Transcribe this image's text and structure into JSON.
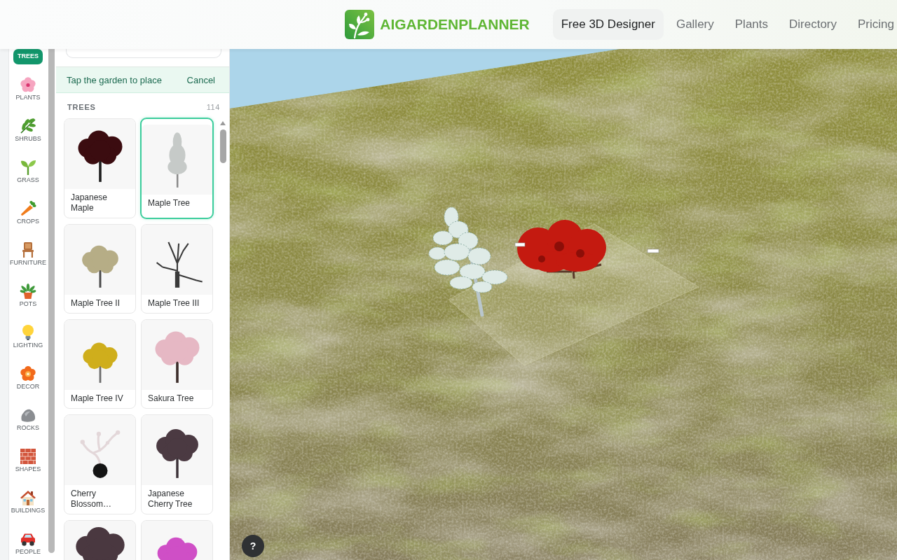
{
  "header": {
    "logo": "AIGARDENPLANNER",
    "nav": [
      {
        "label": "Free 3D Designer",
        "selected": true
      },
      {
        "label": "Gallery",
        "selected": false
      },
      {
        "label": "Plants",
        "selected": false
      },
      {
        "label": "Directory",
        "selected": false
      },
      {
        "label": "Pricing",
        "selected": false
      }
    ]
  },
  "category_rail": {
    "items": [
      {
        "label": "TREES",
        "selected": true
      },
      {
        "label": "PLANTS",
        "selected": false
      },
      {
        "label": "SHRUBS",
        "selected": false
      },
      {
        "label": "GRASS",
        "selected": false
      },
      {
        "label": "CROPS",
        "selected": false
      },
      {
        "label": "FURNITURE",
        "selected": false
      },
      {
        "label": "POTS",
        "selected": false
      },
      {
        "label": "LIGHTING",
        "selected": false
      },
      {
        "label": "DECOR",
        "selected": false
      },
      {
        "label": "ROCKS",
        "selected": false
      },
      {
        "label": "SHAPES",
        "selected": false
      },
      {
        "label": "BUILDINGS",
        "selected": false
      },
      {
        "label": "PEOPLE",
        "selected": false
      }
    ]
  },
  "catalog_panel": {
    "placement_banner": {
      "message": "Tap the garden to place",
      "action": "Cancel"
    },
    "section": {
      "title": "TREES",
      "count": "114"
    },
    "items": [
      {
        "name": "Japanese Maple",
        "selected": false
      },
      {
        "name": "Maple Tree",
        "selected": true
      },
      {
        "name": "Maple Tree II",
        "selected": false
      },
      {
        "name": "Maple Tree III",
        "selected": false
      },
      {
        "name": "Maple Tree IV",
        "selected": false
      },
      {
        "name": "Sakura Tree",
        "selected": false
      },
      {
        "name": "Cherry Blossom…",
        "selected": false
      },
      {
        "name": "Japanese Cherry Tree",
        "selected": false
      },
      {
        "selected": false
      },
      {
        "selected": false
      }
    ]
  },
  "viewport": {
    "help_button": "?"
  }
}
